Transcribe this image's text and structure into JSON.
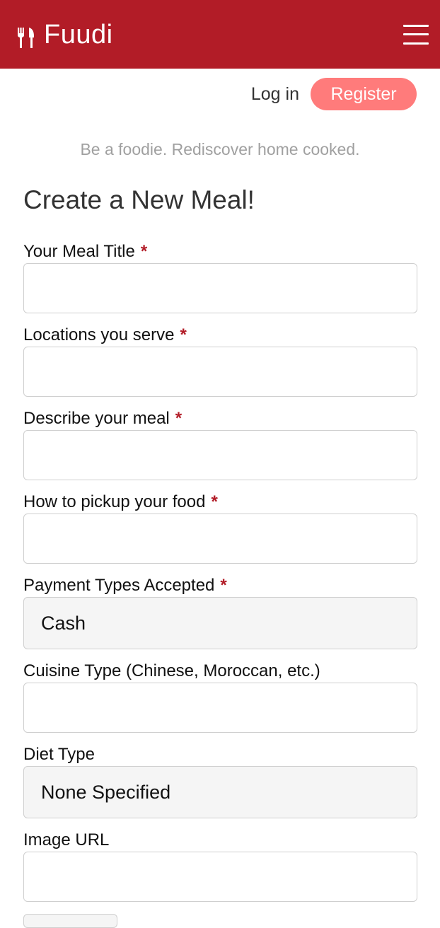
{
  "header": {
    "brand_name": "Fuudi",
    "brand_icon": "fork-knife-icon",
    "menu_icon": "hamburger-menu-icon",
    "background_color": "#b21c27"
  },
  "auth": {
    "login_label": "Log in",
    "register_label": "Register",
    "register_color": "#ff7b7b"
  },
  "tagline": "Be a foodie. Rediscover home cooked.",
  "page_title": "Create a New Meal!",
  "form": {
    "required_marker": "*",
    "fields": [
      {
        "label": "Your Meal Title",
        "required": true,
        "type": "text",
        "value": ""
      },
      {
        "label": "Locations you serve",
        "required": true,
        "type": "text",
        "value": ""
      },
      {
        "label": "Describe your meal",
        "required": true,
        "type": "text",
        "value": ""
      },
      {
        "label": "How to pickup your food",
        "required": true,
        "type": "text",
        "value": ""
      },
      {
        "label": "Payment Types Accepted",
        "required": true,
        "type": "select",
        "value": "Cash"
      },
      {
        "label": "Cuisine Type (Chinese, Moroccan, etc.)",
        "required": false,
        "type": "text",
        "value": ""
      },
      {
        "label": "Diet Type",
        "required": false,
        "type": "select",
        "value": "None Specified"
      },
      {
        "label": "Image URL",
        "required": false,
        "type": "text",
        "value": ""
      }
    ]
  }
}
